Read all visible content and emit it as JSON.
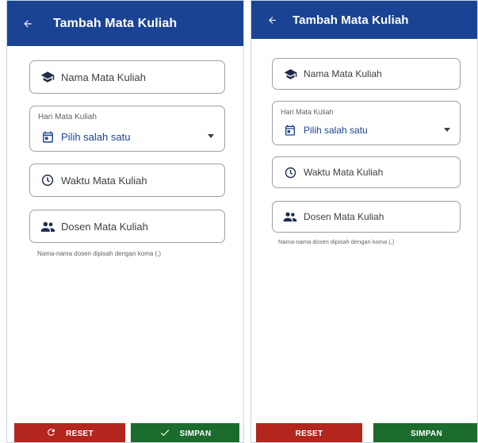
{
  "left": {
    "title": "Tambah Mata Kuliah",
    "course_name_placeholder": "Nama Mata Kuliah",
    "day_label": "Hari Mata Kuliah",
    "day_value": "Pilih salah satu",
    "time_placeholder": "Waktu Mata Kuliah",
    "lecturer_placeholder": "Dosen Mata Kuliah",
    "helper": "Nama-nama dosen dipisah dengan koma (,)",
    "reset_label": "RESET",
    "save_label": "SIMPAN"
  },
  "right": {
    "title": "Tambah Mata Kuliah",
    "course_name_placeholder": "Nama Mata Kuliah",
    "day_label": "Hari Mata Kuliah",
    "day_value": "Pilih salah satu",
    "time_placeholder": "Waktu Mata Kuliah",
    "lecturer_placeholder": "Dosen Mata Kuliah",
    "helper": "Nama-nama dosen dipisah dengan koma (,)",
    "reset_label": "RESET",
    "save_label": "SIMPAN"
  },
  "icons": {
    "back": "arrow-left",
    "course": "school-cap",
    "day": "calendar",
    "time": "clock",
    "lecturer": "people",
    "dropdown": "caret-down",
    "reset": "refresh",
    "save": "check"
  },
  "colors": {
    "appbar": "#1a4393",
    "accent_text": "#1a4393",
    "reset_button": "#b3261e",
    "save_button": "#1b6b2c",
    "field_border": "#9aa0a6"
  }
}
